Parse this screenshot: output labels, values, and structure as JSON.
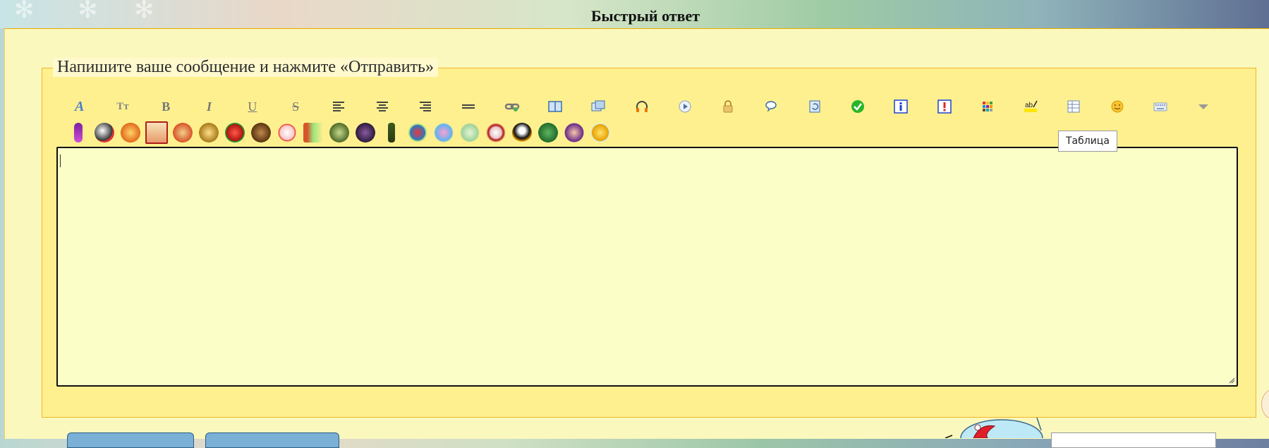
{
  "header": {
    "title": "Быстрый ответ"
  },
  "form": {
    "legend": "Напишите ваше сообщение и нажмите «Отправить»"
  },
  "toolbar": {
    "buttons": [
      {
        "name": "font-color-icon"
      },
      {
        "name": "font-size-icon"
      },
      {
        "name": "bold-icon"
      },
      {
        "name": "italic-icon"
      },
      {
        "name": "underline-icon"
      },
      {
        "name": "strikethrough-icon"
      },
      {
        "name": "align-left-icon"
      },
      {
        "name": "align-center-icon"
      },
      {
        "name": "align-right-icon"
      },
      {
        "name": "horizontal-rule-icon"
      },
      {
        "name": "link-icon"
      },
      {
        "name": "book-icon"
      },
      {
        "name": "gallery-icon"
      },
      {
        "name": "headphones-icon"
      },
      {
        "name": "play-icon"
      },
      {
        "name": "lock-icon"
      },
      {
        "name": "speech-bubble-icon"
      },
      {
        "name": "refresh-document-icon"
      },
      {
        "name": "check-icon"
      },
      {
        "name": "info-icon"
      },
      {
        "name": "warning-icon"
      },
      {
        "name": "color-grid-icon"
      },
      {
        "name": "spellcheck-icon"
      },
      {
        "name": "table-icon"
      },
      {
        "name": "smiley-icon"
      },
      {
        "name": "keyboard-icon"
      },
      {
        "name": "more-dropdown-icon"
      }
    ],
    "tooltip": "Таблица"
  },
  "smilies_count": 21,
  "colors": {
    "panel_bg": "#fbf8bd",
    "fieldset_bg": "#fff08f",
    "editor_bg": "#fbfec6",
    "border_accent": "#f0b42a",
    "check_green": "#2ab52a",
    "info_blue": "#1d43c8",
    "warning_red": "#e02424"
  }
}
